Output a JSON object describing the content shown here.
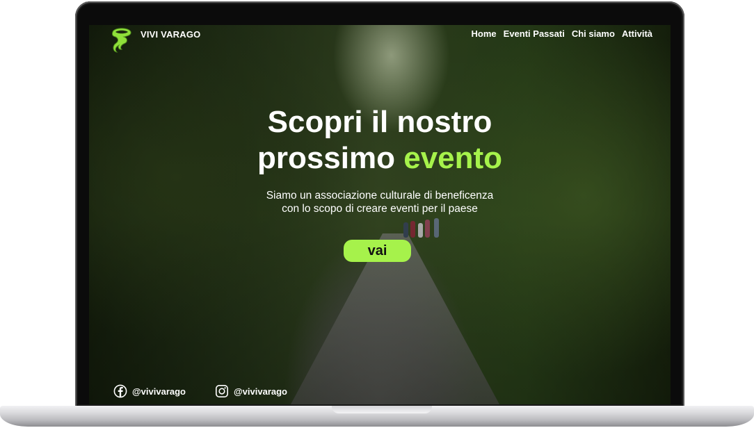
{
  "header": {
    "brand": "VIVI VARAGO",
    "logo_icon": "frog-logo-icon",
    "nav": [
      {
        "label": "Home"
      },
      {
        "label": "Eventi Passati"
      },
      {
        "label": "Chi siamo"
      },
      {
        "label": "Attività"
      }
    ]
  },
  "hero": {
    "title_line1": "Scopri il nostro",
    "title_line2_plain": "prossimo ",
    "title_line2_accent": "evento",
    "subtitle_line1": "Siamo un associazione culturale di beneficenza",
    "subtitle_line2": "con lo scopo di creare eventi per il paese",
    "cta_label": "vai"
  },
  "footer": {
    "facebook": {
      "icon": "facebook-icon",
      "handle": "@vivivarago"
    },
    "instagram": {
      "icon": "instagram-icon",
      "handle": "@vivivarago"
    }
  },
  "colors": {
    "accent": "#a6f24b",
    "text": "#ffffff",
    "frame": "#0b0b0b"
  }
}
